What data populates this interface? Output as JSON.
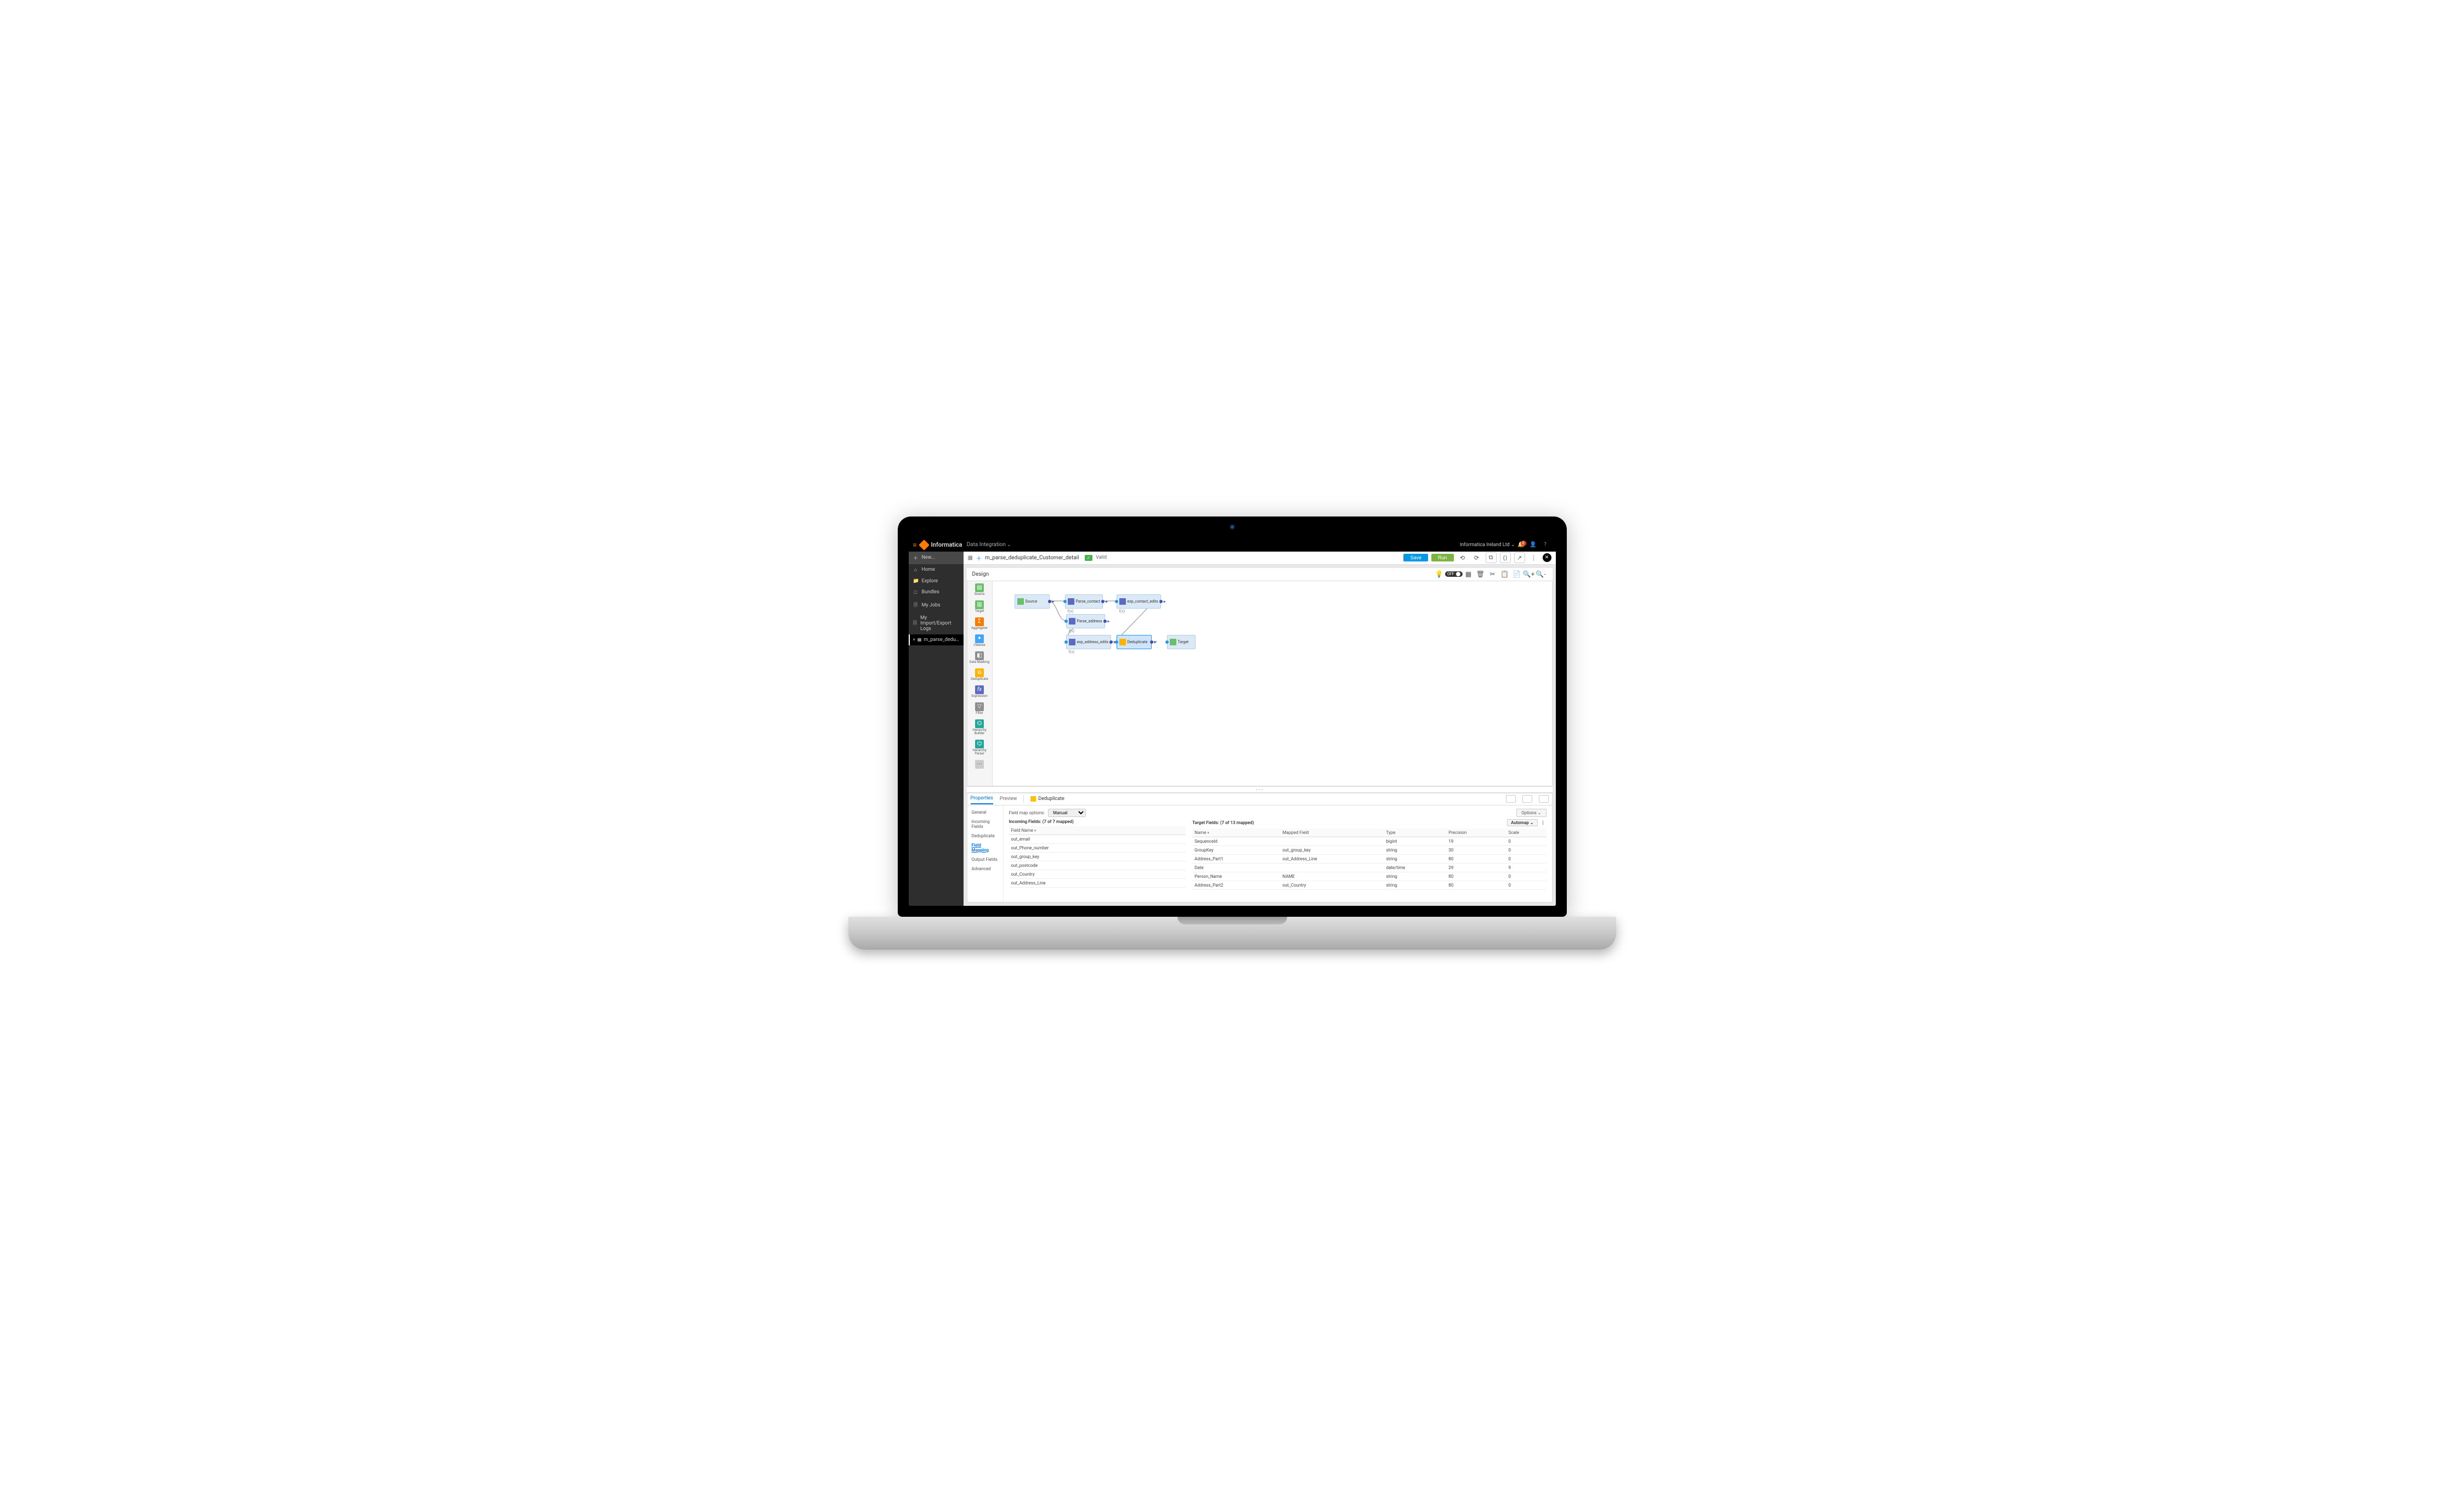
{
  "topbar": {
    "brand": "Informatica",
    "product": "Data Integration",
    "org": "Informatica Ireland Ltd",
    "notification_count": "0"
  },
  "sidebar": {
    "items": [
      {
        "icon": "＋",
        "label": "New..."
      },
      {
        "icon": "⌂",
        "label": "Home"
      },
      {
        "icon": "📁",
        "label": "Explore"
      },
      {
        "icon": "□",
        "label": "Bundles"
      },
      {
        "icon": "🗎",
        "label": "My Jobs"
      },
      {
        "icon": "🗎",
        "label": "My Import/Export Logs"
      }
    ],
    "open_tab": {
      "label": "m_parse_deduplica...",
      "close": "×"
    }
  },
  "header": {
    "title": "m_parse_deduplicate_Customer_detail",
    "valid_label": "Valid",
    "save": "Save",
    "run": "Run"
  },
  "design_bar": {
    "label": "Design",
    "toggle": "OFF"
  },
  "palette": [
    {
      "label": "Source",
      "color": "#6ac06a"
    },
    {
      "label": "Target",
      "color": "#6ac06a"
    },
    {
      "label": "Aggregator",
      "color": "#f57c00"
    },
    {
      "label": "Cleanse",
      "color": "#42a5f5"
    },
    {
      "label": "Data Masking",
      "color": "#8e8e8e"
    },
    {
      "label": "Deduplicate",
      "color": "#ffb300"
    },
    {
      "label": "Expression",
      "color": "#5c6bc0"
    },
    {
      "label": "Filter",
      "color": "#8e8e8e"
    },
    {
      "label": "Hierarchy Builder",
      "color": "#26a69a"
    },
    {
      "label": "Hierarchy Parser",
      "color": "#26a69a"
    }
  ],
  "nodes": {
    "source": {
      "label": "Source"
    },
    "parse_contact": {
      "label": "Parse_contact",
      "sub": "f(x)"
    },
    "exp_contact_edit": {
      "label": "exp_contact_edits",
      "sub": "f(x)"
    },
    "parse_address": {
      "label": "Parse_address",
      "sub": "f(x)"
    },
    "exp_address_edit": {
      "label": "exp_address_edits",
      "sub": "f(x)"
    },
    "deduplicate": {
      "label": "Deduplicate"
    },
    "target": {
      "label": "Target"
    }
  },
  "props": {
    "tabs": {
      "properties": "Properties",
      "preview": "Preview"
    },
    "object_name": "Deduplicate",
    "side": [
      "General",
      "Incoming Fields",
      "Deduplicate",
      "Field Mapping",
      "Output Fields",
      "Advanced"
    ],
    "active_side": "Field Mapping",
    "field_map_label": "Field map options:",
    "field_map_value": "Manual",
    "options_label": "Options",
    "automap_label": "Automap",
    "incoming_title": "Incoming Fields: (7 of 7 mapped)",
    "target_title": "Target Fields: (7 of 13 mapped)",
    "incoming_cols": [
      "Field Name"
    ],
    "incoming_rows": [
      [
        "out_email"
      ],
      [
        "out_Phone_number"
      ],
      [
        "out_group_key"
      ],
      [
        "out_postcode"
      ],
      [
        "out_Country"
      ],
      [
        "out_Address_Line"
      ]
    ],
    "target_cols": [
      "Name",
      "Mapped Field",
      "Type",
      "Precision",
      "Scale"
    ],
    "target_rows": [
      [
        "SequenceId",
        "",
        "bigint",
        "19",
        "0"
      ],
      [
        "GroupKey",
        "out_group_key",
        "string",
        "30",
        "0"
      ],
      [
        "Address_Part1",
        "out_Address_Line",
        "string",
        "80",
        "0"
      ],
      [
        "Date",
        "",
        "date/time",
        "29",
        "9"
      ],
      [
        "Person_Name",
        "NAME",
        "string",
        "80",
        "0"
      ],
      [
        "Address_Part2",
        "out_Country",
        "string",
        "80",
        "0"
      ]
    ]
  }
}
